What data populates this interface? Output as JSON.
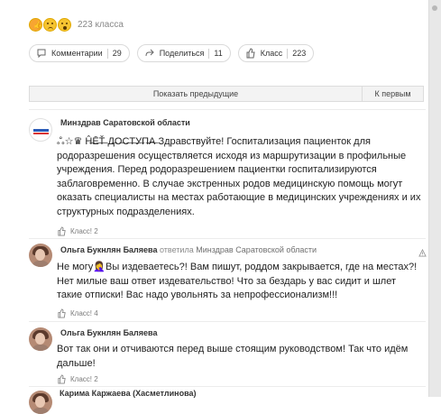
{
  "reactions": {
    "icons": [
      "like-icon",
      "sad-icon",
      "surprised-icon"
    ],
    "count_text": "223 класса"
  },
  "actions": {
    "comments": {
      "label": "Комментарии",
      "count": "29"
    },
    "share": {
      "label": "Поделиться",
      "count": "11"
    },
    "like": {
      "label": "Класс",
      "count": "223"
    }
  },
  "pager": {
    "show_previous": "Показать предыдущие",
    "to_first": "К первым"
  },
  "comments": [
    {
      "author": "Минздрав Саратовской области",
      "text_prefix": "ஃ☆♛ Ĥ̶Ē̶Ť̶ Д̶О̶С̶Т̶У̶П̶А̶",
      "text": "Здравствуйте! Госпитализация пациенток для родоразрешения осуществляется исходя из маршрутизации в профильные учреждения. Перед родоразрешением пациентки госпитализируются заблаговременно. В случае экстренных родов медицинскую помощь могут оказать специалисты на местах работающие в медицинских учреждениях и их структурных подразделениях.",
      "likes": "Класс! 2"
    },
    {
      "author": "Ольга Букнлян Баляева",
      "reply_word": "ответила",
      "reply_target": "Минздрав Саратовской области",
      "text": "Не могу🤦‍♀️Вы издеваетесь?! Вам пишут, роддом закрывается, где на местах?! Нет милые ваш ответ издевательство! Что за бездарь у вас сидит и шлет такие отписки! Вас надо увольнять за непрофессионализм!!!",
      "likes": "Класс! 4"
    },
    {
      "author": "Ольга Букнлян Баляева",
      "text": "Вот так они и отчиваются перед выше стоящим руководством! Так что идём дальше!",
      "likes": "Класс! 2"
    }
  ],
  "next_author_partial": "Карима Каржаева (Хасметлинова)"
}
